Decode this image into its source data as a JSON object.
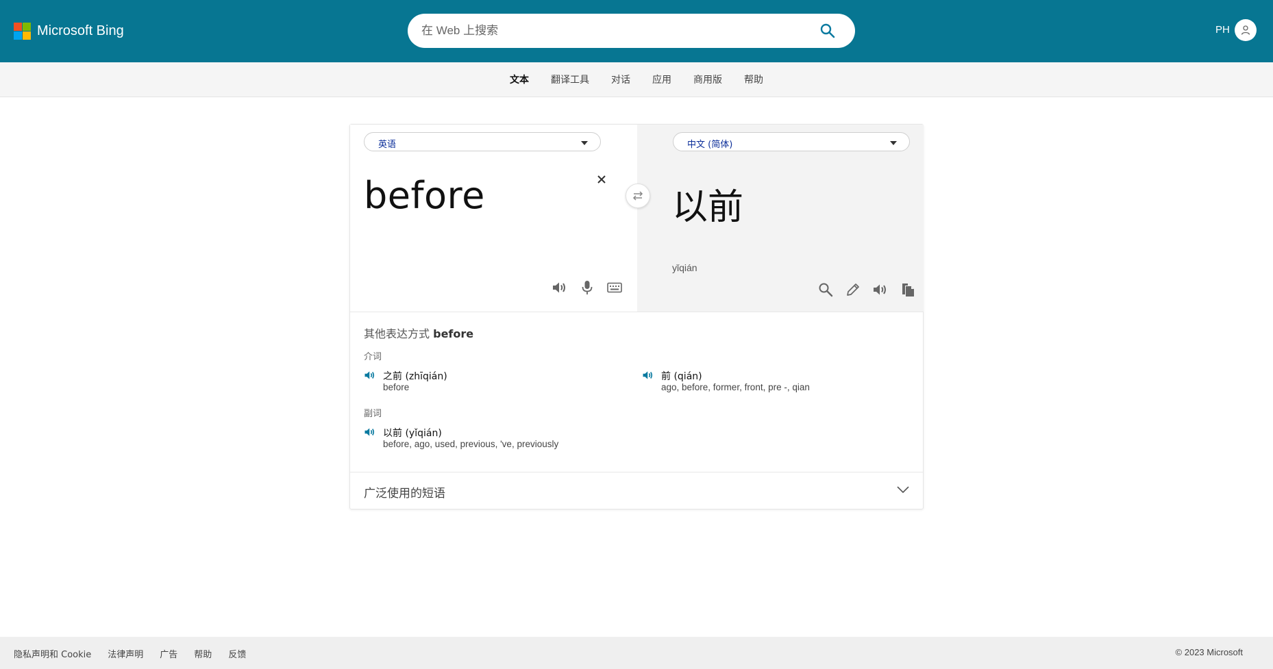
{
  "header": {
    "brand": "Microsoft Bing",
    "search_placeholder": "在 Web 上搜索",
    "user_initials": "PH",
    "logo_colors": [
      "#f25022",
      "#7fba00",
      "#00a4ef",
      "#ffb900"
    ]
  },
  "subnav": {
    "items": [
      {
        "label": "文本",
        "active": true
      },
      {
        "label": "翻译工具"
      },
      {
        "label": "对话"
      },
      {
        "label": "应用"
      },
      {
        "label": "商用版"
      },
      {
        "label": "帮助"
      }
    ]
  },
  "translator": {
    "source_lang": "英语",
    "target_lang": "中文 (简体)",
    "source_text": "before",
    "target_text": "以前",
    "transliteration": "yǐqián",
    "source_icons": [
      "speaker-icon",
      "microphone-icon",
      "keyboard-icon"
    ],
    "target_icons": [
      "search-icon",
      "pencil-icon",
      "speaker-icon",
      "copy-icon"
    ]
  },
  "alternatives": {
    "title_prefix": "其他表达方式",
    "title_word": "before",
    "groups": [
      {
        "pos": "介词",
        "entries": [
          {
            "term": "之前 (zhīqián)",
            "meaning": "before"
          },
          {
            "term": "前 (qián)",
            "meaning": "ago, before, former, front, pre -, qian"
          }
        ]
      },
      {
        "pos": "副词",
        "entries": [
          {
            "term": "以前 (yǐqián)",
            "meaning": "before, ago, used, previous, 've, previously"
          }
        ]
      }
    ]
  },
  "phrases": {
    "label": "广泛使用的短语"
  },
  "footer": {
    "links": [
      "隐私声明和 Cookie",
      "法律声明",
      "广告",
      "帮助",
      "反馈"
    ],
    "copyright": "© 2023 Microsoft"
  },
  "colors": {
    "header_bg": "#077692",
    "accent": "#0a7aa0",
    "lang_text": "#0a2d99"
  }
}
